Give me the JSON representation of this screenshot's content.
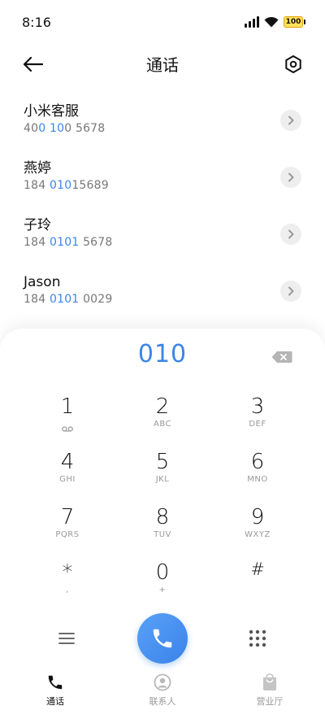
{
  "status_bar": {
    "time": "8:16",
    "battery": "100"
  },
  "header": {
    "title": "通话"
  },
  "contacts": [
    {
      "name": "小米客服",
      "number_pre": "40",
      "number_hl": "0 10",
      "number_post": "0 5678"
    },
    {
      "name": "燕婷",
      "number_pre": "184 ",
      "number_hl": "010",
      "number_post": "15689"
    },
    {
      "name": "子玲",
      "number_pre": "184 ",
      "number_hl": "0101",
      "number_post": " 5678"
    },
    {
      "name": "Jason",
      "number_pre": "184 ",
      "number_hl": "0101",
      "number_post": " 0029"
    }
  ],
  "dialpad": {
    "display_value": "010",
    "keys": [
      {
        "digit": "1",
        "letters": ""
      },
      {
        "digit": "2",
        "letters": "ABC"
      },
      {
        "digit": "3",
        "letters": "DEF"
      },
      {
        "digit": "4",
        "letters": "GHI"
      },
      {
        "digit": "5",
        "letters": "JKL"
      },
      {
        "digit": "6",
        "letters": "MNO"
      },
      {
        "digit": "7",
        "letters": "PQRS"
      },
      {
        "digit": "8",
        "letters": "TUV"
      },
      {
        "digit": "9",
        "letters": "WXYZ"
      },
      {
        "digit": "*",
        "letters": ","
      },
      {
        "digit": "0",
        "letters": "+"
      },
      {
        "digit": "#",
        "letters": ""
      }
    ]
  },
  "bottom_nav": {
    "tabs": [
      {
        "label": "通话",
        "icon": "phone-icon",
        "active": true
      },
      {
        "label": "联系人",
        "icon": "contacts-icon",
        "active": false
      },
      {
        "label": "营业厅",
        "icon": "shopping-bag-icon",
        "active": false
      }
    ]
  },
  "colors": {
    "accent": "#3a86e8",
    "text_primary": "#111111",
    "text_secondary": "#777777"
  }
}
